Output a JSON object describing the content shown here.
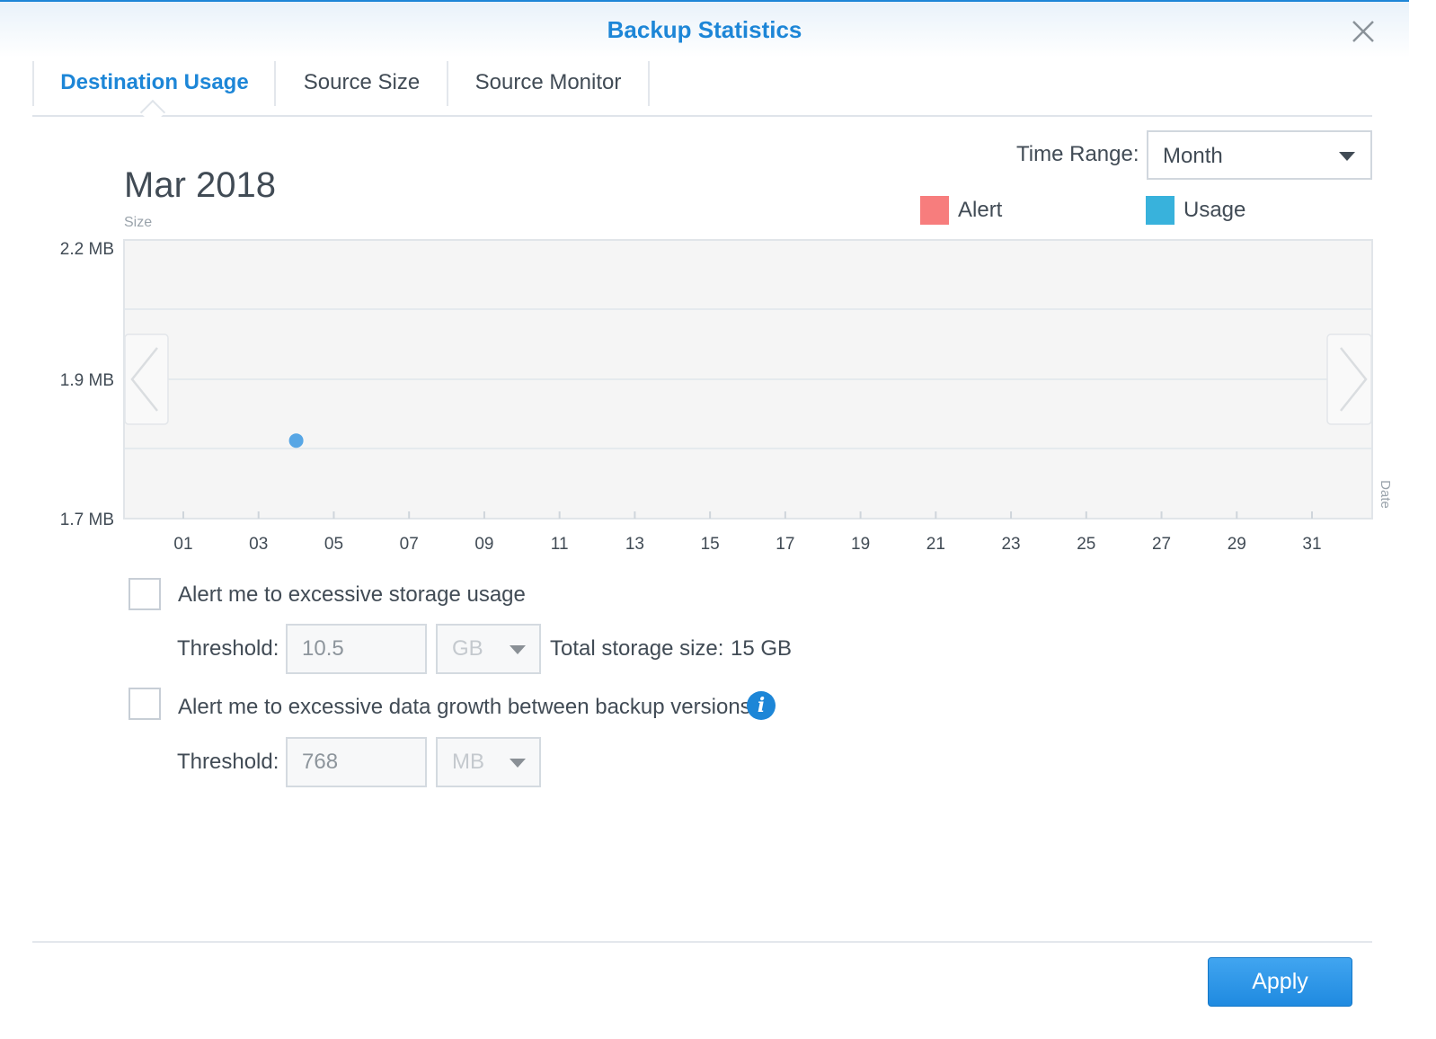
{
  "dialog": {
    "title": "Backup Statistics",
    "accent_color": "#1d86d7"
  },
  "tabs": [
    {
      "label": "Destination Usage",
      "active": true
    },
    {
      "label": "Source Size",
      "active": false
    },
    {
      "label": "Source Monitor",
      "active": false
    }
  ],
  "time_range": {
    "label": "Time Range:",
    "value": "Month"
  },
  "chart_header": {
    "period": "Mar 2018"
  },
  "chart_data": {
    "type": "scatter",
    "ylabel": "Size",
    "xlabel": "Date",
    "y_ticks": [
      "2.2 MB",
      "1.9 MB",
      "1.7 MB"
    ],
    "x_ticks": [
      "01",
      "03",
      "05",
      "07",
      "09",
      "11",
      "13",
      "15",
      "17",
      "19",
      "21",
      "23",
      "25",
      "27",
      "29",
      "31"
    ],
    "xlim": [
      1,
      32
    ],
    "ylim_mb": [
      1.7,
      2.2
    ],
    "grid": true,
    "legend": [
      {
        "name": "Alert",
        "color": "#f77d7d"
      },
      {
        "name": "Usage",
        "color": "#38b2dc"
      }
    ],
    "series": [
      {
        "name": "Usage",
        "color": "#57a6e5",
        "points": [
          {
            "x": 4,
            "y": 1.84
          }
        ]
      }
    ]
  },
  "alerts": {
    "storage": {
      "label": "Alert me to excessive storage usage",
      "checked": false,
      "threshold_label": "Threshold:",
      "threshold_value": "10.5",
      "unit": "GB",
      "total_label": "Total storage size:",
      "total_value": "15 GB"
    },
    "growth": {
      "label": "Alert me to excessive data growth between backup versions",
      "checked": false,
      "threshold_label": "Threshold:",
      "threshold_value": "768",
      "unit": "MB"
    }
  },
  "footer": {
    "apply_label": "Apply"
  },
  "icons": {
    "close": "close-icon",
    "info": "info-icon",
    "info_glyph": "i",
    "prev": "chevron-left-icon",
    "next": "chevron-right-icon",
    "dropdown": "caret-down-icon"
  }
}
